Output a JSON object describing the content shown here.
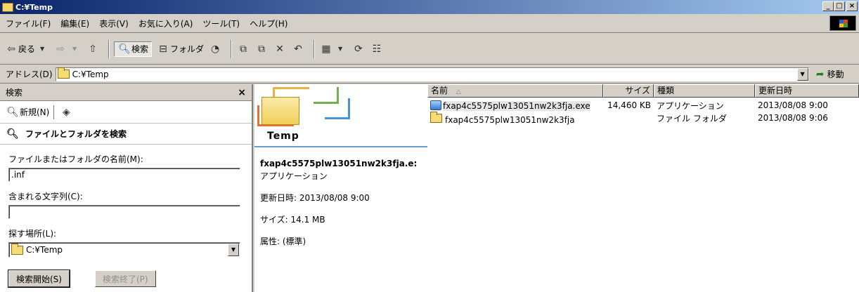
{
  "window": {
    "title": "C:¥Temp"
  },
  "window_buttons": {
    "minimize": "_",
    "maximize": "□",
    "close": "×"
  },
  "menu": [
    "ファイル(F)",
    "編集(E)",
    "表示(V)",
    "お気に入り(A)",
    "ツール(T)",
    "ヘルプ(H)"
  ],
  "toolbar": {
    "back": "戻る",
    "search": "検索",
    "folders": "フォルダ"
  },
  "address": {
    "label": "アドレス(D)",
    "value": "C:¥Temp",
    "go": "移動"
  },
  "search_pane": {
    "header": "検索",
    "close": "×",
    "new_search": "新規(N)",
    "section_title": "ファイルとフォルダを検索",
    "name_label": "ファイルまたはフォルダの名前(M):",
    "name_value": ".inf",
    "contains_label": "含まれる文字列(C):",
    "contains_value": "",
    "look_in_label": "探す場所(L):",
    "look_in_value": "C:¥Temp",
    "start_button": "検索開始(S)",
    "stop_button": "検索終了(P)"
  },
  "detail_pane": {
    "folder_name": "Temp",
    "selected_file": "fxap4c5575plw13051nw2k3fja.e:",
    "selected_type": "アプリケーション",
    "modified": "更新日時: 2013/08/08 9:00",
    "size": "サイズ: 14.1 MB",
    "attributes": "属性: (標準)"
  },
  "file_list": {
    "columns": [
      "名前",
      "サイズ",
      "種類",
      "更新日時"
    ],
    "sort_indicator": "△",
    "rows": [
      {
        "name": "fxap4c5575plw13051nw2k3fja.exe",
        "size": "14,460 KB",
        "type": "アプリケーション",
        "modified": "2013/08/08 9:00",
        "icon": "exe-icon"
      },
      {
        "name": "fxap4c5575plw13051nw2k3fja",
        "size": "",
        "type": "ファイル フォルダ",
        "modified": "2013/08/08 9:06",
        "icon": "folder-icon"
      }
    ]
  }
}
